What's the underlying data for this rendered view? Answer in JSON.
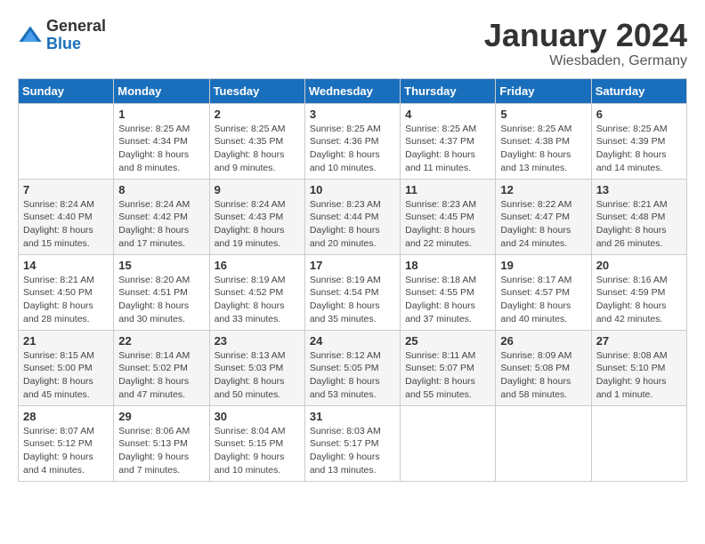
{
  "header": {
    "logo_general": "General",
    "logo_blue": "Blue",
    "month_title": "January 2024",
    "location": "Wiesbaden, Germany"
  },
  "days_of_week": [
    "Sunday",
    "Monday",
    "Tuesday",
    "Wednesday",
    "Thursday",
    "Friday",
    "Saturday"
  ],
  "weeks": [
    [
      {
        "num": "",
        "sunrise": "",
        "sunset": "",
        "daylight": ""
      },
      {
        "num": "1",
        "sunrise": "Sunrise: 8:25 AM",
        "sunset": "Sunset: 4:34 PM",
        "daylight": "Daylight: 8 hours and 8 minutes."
      },
      {
        "num": "2",
        "sunrise": "Sunrise: 8:25 AM",
        "sunset": "Sunset: 4:35 PM",
        "daylight": "Daylight: 8 hours and 9 minutes."
      },
      {
        "num": "3",
        "sunrise": "Sunrise: 8:25 AM",
        "sunset": "Sunset: 4:36 PM",
        "daylight": "Daylight: 8 hours and 10 minutes."
      },
      {
        "num": "4",
        "sunrise": "Sunrise: 8:25 AM",
        "sunset": "Sunset: 4:37 PM",
        "daylight": "Daylight: 8 hours and 11 minutes."
      },
      {
        "num": "5",
        "sunrise": "Sunrise: 8:25 AM",
        "sunset": "Sunset: 4:38 PM",
        "daylight": "Daylight: 8 hours and 13 minutes."
      },
      {
        "num": "6",
        "sunrise": "Sunrise: 8:25 AM",
        "sunset": "Sunset: 4:39 PM",
        "daylight": "Daylight: 8 hours and 14 minutes."
      }
    ],
    [
      {
        "num": "7",
        "sunrise": "Sunrise: 8:24 AM",
        "sunset": "Sunset: 4:40 PM",
        "daylight": "Daylight: 8 hours and 15 minutes."
      },
      {
        "num": "8",
        "sunrise": "Sunrise: 8:24 AM",
        "sunset": "Sunset: 4:42 PM",
        "daylight": "Daylight: 8 hours and 17 minutes."
      },
      {
        "num": "9",
        "sunrise": "Sunrise: 8:24 AM",
        "sunset": "Sunset: 4:43 PM",
        "daylight": "Daylight: 8 hours and 19 minutes."
      },
      {
        "num": "10",
        "sunrise": "Sunrise: 8:23 AM",
        "sunset": "Sunset: 4:44 PM",
        "daylight": "Daylight: 8 hours and 20 minutes."
      },
      {
        "num": "11",
        "sunrise": "Sunrise: 8:23 AM",
        "sunset": "Sunset: 4:45 PM",
        "daylight": "Daylight: 8 hours and 22 minutes."
      },
      {
        "num": "12",
        "sunrise": "Sunrise: 8:22 AM",
        "sunset": "Sunset: 4:47 PM",
        "daylight": "Daylight: 8 hours and 24 minutes."
      },
      {
        "num": "13",
        "sunrise": "Sunrise: 8:21 AM",
        "sunset": "Sunset: 4:48 PM",
        "daylight": "Daylight: 8 hours and 26 minutes."
      }
    ],
    [
      {
        "num": "14",
        "sunrise": "Sunrise: 8:21 AM",
        "sunset": "Sunset: 4:50 PM",
        "daylight": "Daylight: 8 hours and 28 minutes."
      },
      {
        "num": "15",
        "sunrise": "Sunrise: 8:20 AM",
        "sunset": "Sunset: 4:51 PM",
        "daylight": "Daylight: 8 hours and 30 minutes."
      },
      {
        "num": "16",
        "sunrise": "Sunrise: 8:19 AM",
        "sunset": "Sunset: 4:52 PM",
        "daylight": "Daylight: 8 hours and 33 minutes."
      },
      {
        "num": "17",
        "sunrise": "Sunrise: 8:19 AM",
        "sunset": "Sunset: 4:54 PM",
        "daylight": "Daylight: 8 hours and 35 minutes."
      },
      {
        "num": "18",
        "sunrise": "Sunrise: 8:18 AM",
        "sunset": "Sunset: 4:55 PM",
        "daylight": "Daylight: 8 hours and 37 minutes."
      },
      {
        "num": "19",
        "sunrise": "Sunrise: 8:17 AM",
        "sunset": "Sunset: 4:57 PM",
        "daylight": "Daylight: 8 hours and 40 minutes."
      },
      {
        "num": "20",
        "sunrise": "Sunrise: 8:16 AM",
        "sunset": "Sunset: 4:59 PM",
        "daylight": "Daylight: 8 hours and 42 minutes."
      }
    ],
    [
      {
        "num": "21",
        "sunrise": "Sunrise: 8:15 AM",
        "sunset": "Sunset: 5:00 PM",
        "daylight": "Daylight: 8 hours and 45 minutes."
      },
      {
        "num": "22",
        "sunrise": "Sunrise: 8:14 AM",
        "sunset": "Sunset: 5:02 PM",
        "daylight": "Daylight: 8 hours and 47 minutes."
      },
      {
        "num": "23",
        "sunrise": "Sunrise: 8:13 AM",
        "sunset": "Sunset: 5:03 PM",
        "daylight": "Daylight: 8 hours and 50 minutes."
      },
      {
        "num": "24",
        "sunrise": "Sunrise: 8:12 AM",
        "sunset": "Sunset: 5:05 PM",
        "daylight": "Daylight: 8 hours and 53 minutes."
      },
      {
        "num": "25",
        "sunrise": "Sunrise: 8:11 AM",
        "sunset": "Sunset: 5:07 PM",
        "daylight": "Daylight: 8 hours and 55 minutes."
      },
      {
        "num": "26",
        "sunrise": "Sunrise: 8:09 AM",
        "sunset": "Sunset: 5:08 PM",
        "daylight": "Daylight: 8 hours and 58 minutes."
      },
      {
        "num": "27",
        "sunrise": "Sunrise: 8:08 AM",
        "sunset": "Sunset: 5:10 PM",
        "daylight": "Daylight: 9 hours and 1 minute."
      }
    ],
    [
      {
        "num": "28",
        "sunrise": "Sunrise: 8:07 AM",
        "sunset": "Sunset: 5:12 PM",
        "daylight": "Daylight: 9 hours and 4 minutes."
      },
      {
        "num": "29",
        "sunrise": "Sunrise: 8:06 AM",
        "sunset": "Sunset: 5:13 PM",
        "daylight": "Daylight: 9 hours and 7 minutes."
      },
      {
        "num": "30",
        "sunrise": "Sunrise: 8:04 AM",
        "sunset": "Sunset: 5:15 PM",
        "daylight": "Daylight: 9 hours and 10 minutes."
      },
      {
        "num": "31",
        "sunrise": "Sunrise: 8:03 AM",
        "sunset": "Sunset: 5:17 PM",
        "daylight": "Daylight: 9 hours and 13 minutes."
      },
      {
        "num": "",
        "sunrise": "",
        "sunset": "",
        "daylight": ""
      },
      {
        "num": "",
        "sunrise": "",
        "sunset": "",
        "daylight": ""
      },
      {
        "num": "",
        "sunrise": "",
        "sunset": "",
        "daylight": ""
      }
    ]
  ]
}
